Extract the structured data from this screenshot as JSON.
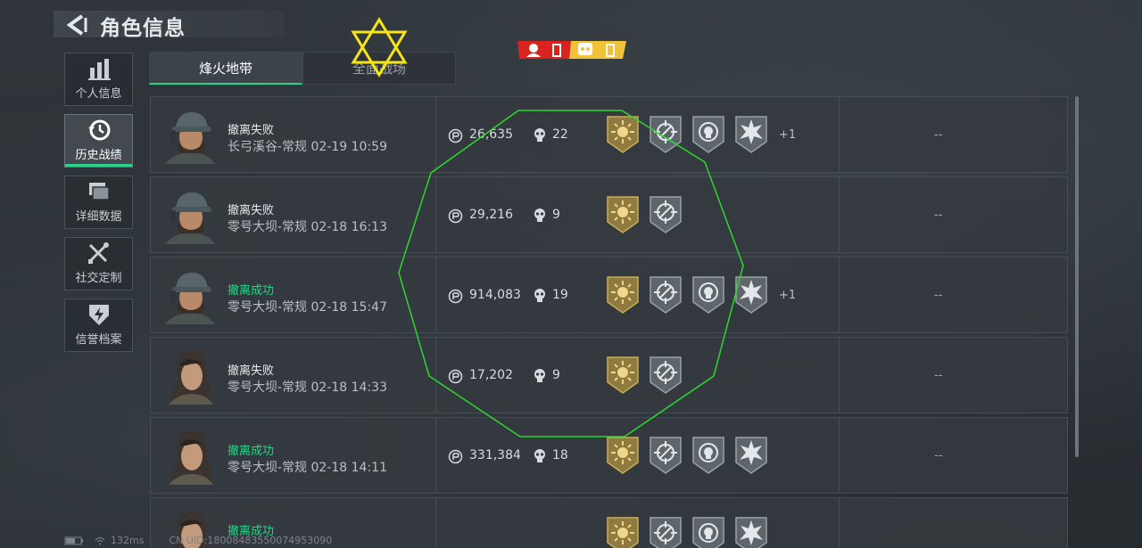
{
  "header": {
    "title": "角色信息"
  },
  "nav": [
    {
      "label": "个人信息",
      "icon": "bar-chart-icon",
      "active": false
    },
    {
      "label": "历史战绩",
      "icon": "history-clock-icon",
      "active": true
    },
    {
      "label": "详细数据",
      "icon": "stacked-cards-icon",
      "active": false
    },
    {
      "label": "社交定制",
      "icon": "wrench-screwdriver-icon",
      "active": false
    },
    {
      "label": "信誉档案",
      "icon": "shield-lightning-icon",
      "active": false
    }
  ],
  "tabs": [
    {
      "label": "烽火地带",
      "active": true
    },
    {
      "label": "全面战场",
      "active": false
    }
  ],
  "records": [
    {
      "result": "撤离失败",
      "success": false,
      "map": "长弓溪谷-常规",
      "time": "02-19 10:59",
      "value": "26,635",
      "kills": "22",
      "badges": 4,
      "extra": "+1",
      "dash": "--",
      "portrait": "male"
    },
    {
      "result": "撤离失败",
      "success": false,
      "map": "零号大坝-常规",
      "time": "02-18 16:13",
      "value": "29,216",
      "kills": "9",
      "badges": 2,
      "extra": "",
      "dash": "--",
      "portrait": "male"
    },
    {
      "result": "撤离成功",
      "success": true,
      "map": "零号大坝-常规",
      "time": "02-18 15:47",
      "value": "914,083",
      "kills": "19",
      "badges": 4,
      "extra": "+1",
      "dash": "--",
      "portrait": "male"
    },
    {
      "result": "撤离失败",
      "success": false,
      "map": "零号大坝-常规",
      "time": "02-18 14:33",
      "value": "17,202",
      "kills": "9",
      "badges": 2,
      "extra": "",
      "dash": "--",
      "portrait": "female"
    },
    {
      "result": "撤离成功",
      "success": true,
      "map": "零号大坝-常规",
      "time": "02-18 14:11",
      "value": "331,384",
      "kills": "18",
      "badges": 4,
      "extra": "",
      "dash": "--",
      "portrait": "female"
    },
    {
      "result": "撤离成功",
      "success": true,
      "map": "",
      "time": "",
      "value": "",
      "kills": "",
      "badges": 4,
      "extra": "",
      "dash": "",
      "portrait": "female"
    }
  ],
  "footer": {
    "ping": "132ms",
    "uid": "CN UID:18008483550074953090"
  },
  "colors": {
    "accent": "#27d48a",
    "badge_gold": "#b59a4e",
    "badge_silver": "#8f979c",
    "alert_red": "#d8231f",
    "alert_yellow": "#f2c23a"
  }
}
